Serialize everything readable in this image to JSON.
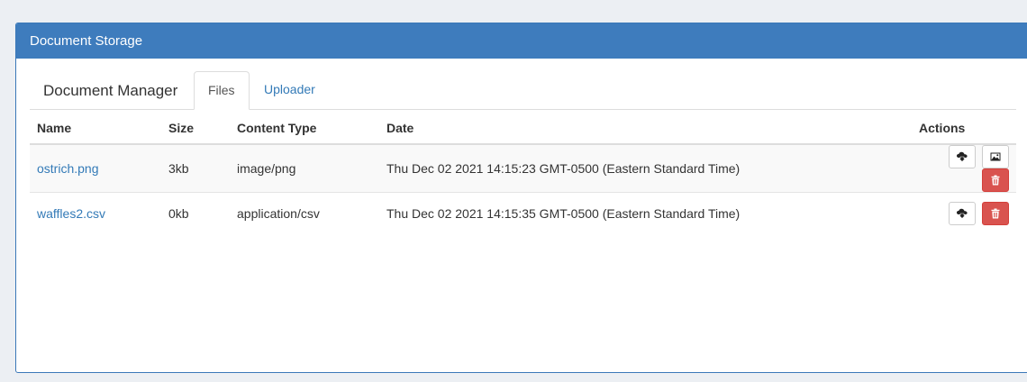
{
  "panel": {
    "title": "Document Storage"
  },
  "manager": {
    "title": "Document Manager",
    "tabs": [
      {
        "label": "Files",
        "active": true
      },
      {
        "label": "Uploader",
        "active": false
      }
    ]
  },
  "table": {
    "columns": [
      "Name",
      "Size",
      "Content Type",
      "Date",
      "Actions"
    ],
    "rows": [
      {
        "name": "ostrich.png",
        "size": "3kb",
        "content_type": "image/png",
        "date": "Thu Dec 02 2021 14:15:23 GMT-0500 (Eastern Standard Time)",
        "actions": [
          "download-icon",
          "image-icon",
          "trash-icon"
        ]
      },
      {
        "name": "waffles2.csv",
        "size": "0kb",
        "content_type": "application/csv",
        "date": "Thu Dec 02 2021 14:15:35 GMT-0500 (Eastern Standard Time)",
        "actions": [
          "download-icon",
          "trash-icon"
        ]
      }
    ]
  },
  "colors": {
    "header_bg": "#3e7cbd",
    "link": "#337ab7",
    "danger": "#d9534f"
  }
}
